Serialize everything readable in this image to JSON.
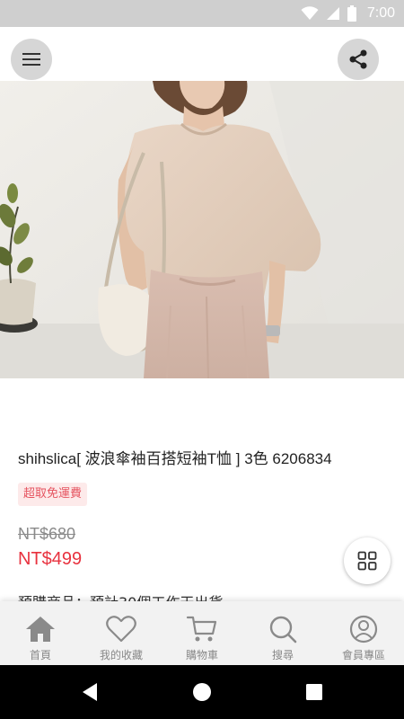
{
  "status_bar": {
    "time": "7:00"
  },
  "product": {
    "image_alt": "Model wearing beige wide-sleeve T-shirt",
    "title": "shihslica[ 波浪傘袖百搭短袖T恤 ] 3色 6206834",
    "promo_badge": "超取免運費",
    "original_price": "NT$680",
    "sale_price": "NT$499",
    "preorder_note": "預購商品：預計30個工作天出貨"
  },
  "bottom_nav": {
    "items": [
      {
        "label": "首頁",
        "icon": "home-icon"
      },
      {
        "label": "我的收藏",
        "icon": "heart-icon"
      },
      {
        "label": "購物車",
        "icon": "cart-icon"
      },
      {
        "label": "搜尋",
        "icon": "search-icon"
      },
      {
        "label": "會員專區",
        "icon": "user-icon"
      }
    ]
  },
  "colors": {
    "accent_red": "#e8323f",
    "badge_bg": "#fdeaea",
    "icon_gray": "#8a8a8a"
  }
}
